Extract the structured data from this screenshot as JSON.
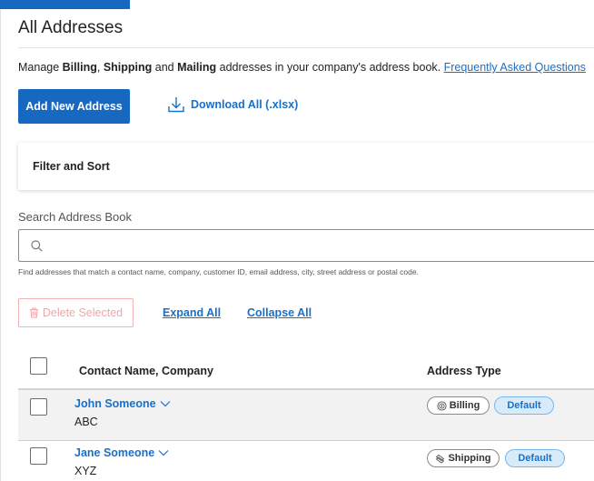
{
  "page": {
    "title": "All Addresses",
    "intro": {
      "prefix": "Manage ",
      "billing": "Billing",
      "sep1": ", ",
      "shipping": "Shipping",
      "sep2": " and ",
      "mailing": "Mailing",
      "suffix": " addresses in your company's address book. ",
      "faq_link": "Frequently Asked Questions"
    }
  },
  "actions": {
    "add_new_label": "Add New Address",
    "download_label": "Download All (.xlsx)"
  },
  "filter": {
    "label": "Filter and Sort"
  },
  "search": {
    "label": "Search Address Book",
    "value": "",
    "hint": "Find addresses that match a contact name, company, customer ID, email address, city, street address or postal code."
  },
  "bulk": {
    "delete_label": "Delete Selected",
    "expand_label": "Expand All",
    "collapse_label": "Collapse All"
  },
  "table": {
    "headers": {
      "contact": "Contact Name, Company",
      "type": "Address Type"
    },
    "rows": [
      {
        "name": "John Someone",
        "company": "ABC",
        "type": "Billing",
        "badge": "Default",
        "checked": false
      },
      {
        "name": "Jane Someone",
        "company": "XYZ",
        "type": "Shipping",
        "badge": "Default",
        "checked": false
      }
    ]
  },
  "colors": {
    "primary": "#1668c1",
    "link": "#1a6fc9",
    "delete_disabled": "#f2a6a6",
    "default_badge_bg": "#d7ebfb",
    "row_alt_bg": "#f2f2f2"
  },
  "icons": {
    "download": "download-icon",
    "search": "search-icon",
    "trash": "trash-icon",
    "chevron": "chevron-down-icon",
    "billing": "billing-icon",
    "shipping": "shipping-icon"
  }
}
